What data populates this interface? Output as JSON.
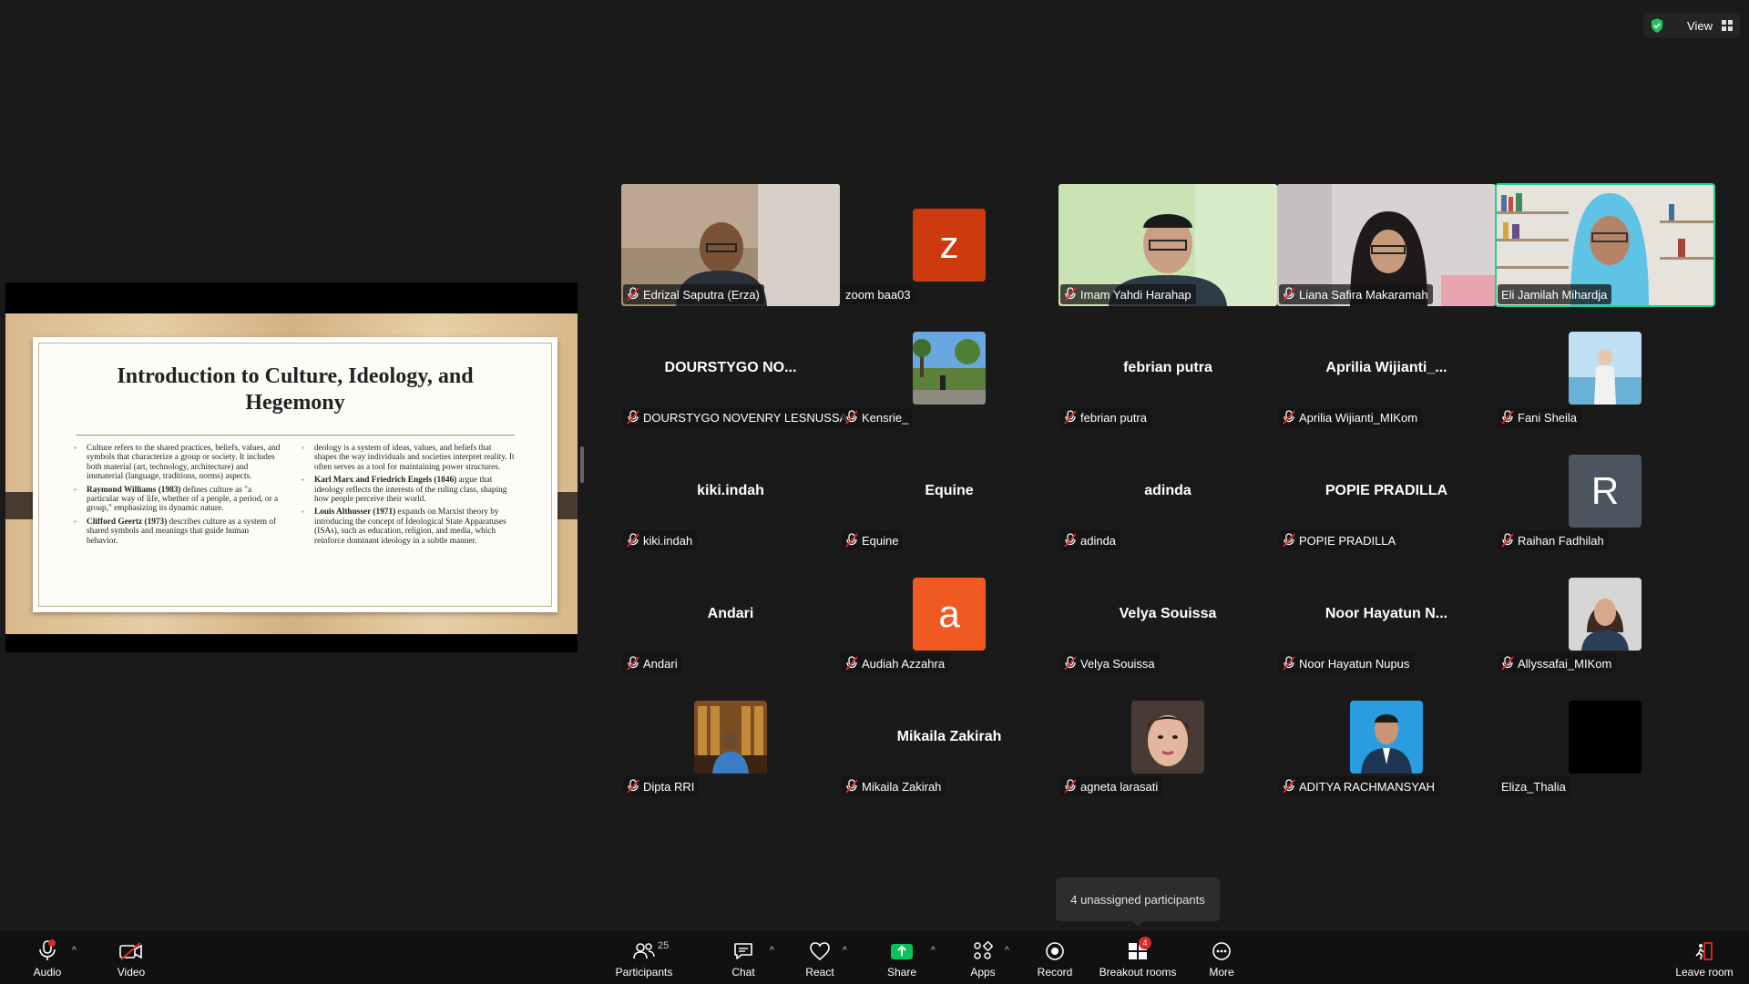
{
  "topbar": {
    "view_label": "View"
  },
  "slide": {
    "title": "Introduction to Culture, Ideology, and\nHegemony",
    "left_bullets": [
      {
        "bold": "",
        "text": "Culture refers to the shared practices, beliefs, values, and symbols that characterize a group or society. It includes both material (art, technology, architecture) and immaterial (language, traditions, norms) aspects."
      },
      {
        "bold": "Raymond Williams (1983)",
        "text": " defines culture as \"a particular way of life, whether of a people, a period, or a group,\" emphasizing its dynamic nature."
      },
      {
        "bold": "Clifford Geertz (1973)",
        "text": " describes culture as a system of shared symbols and meanings that guide human behavior."
      }
    ],
    "right_bullets": [
      {
        "bold": "",
        "text": "deology is a system of ideas, values, and beliefs that shapes the way individuals and societies interpret reality. It often serves as a tool for maintaining power structures."
      },
      {
        "bold": "Karl Marx and Friedrich Engels (1846)",
        "text": " argue that ideology reflects the interests of the ruling class, shaping how people perceive their world."
      },
      {
        "bold": "Louis Althusser (1971)",
        "text": " expands on Marxist theory by introducing the concept of Ideological State Apparatuses (ISAs), such as education, religion, and media, which reinforce dominant ideology in a subtle manner."
      }
    ]
  },
  "participants": [
    {
      "name": "Edrizal Saputra (Erza)",
      "muted": true,
      "type": "video",
      "scene": "man"
    },
    {
      "name": "zoom baa03",
      "muted": false,
      "type": "avatar",
      "letter": "z",
      "color": "#cc3a0e"
    },
    {
      "name": "Imam Yahdi Harahap",
      "muted": true,
      "type": "video",
      "scene": "green"
    },
    {
      "name": "Liana Safira Makaramah",
      "muted": true,
      "type": "video",
      "scene": "hijab"
    },
    {
      "name": "Eli Jamilah Mihardja",
      "muted": false,
      "type": "video",
      "scene": "shelf",
      "active": true
    },
    {
      "name": "DOURSTYGO NOVENRY LESNUSSA",
      "muted": true,
      "type": "name",
      "big": "DOURSTYGO  NO..."
    },
    {
      "name": "Kensrie_",
      "muted": true,
      "type": "avatar",
      "photo": "park"
    },
    {
      "name": "febrian putra",
      "muted": true,
      "type": "name",
      "big": "febrian putra"
    },
    {
      "name": "Aprilia Wijianti_MIKom",
      "muted": true,
      "type": "name",
      "big": "Aprilia  Wijianti_..."
    },
    {
      "name": "Fani Sheila",
      "muted": true,
      "type": "avatar",
      "photo": "sky"
    },
    {
      "name": "kiki.indah",
      "muted": true,
      "type": "name",
      "big": "kiki.indah"
    },
    {
      "name": "Equine",
      "muted": true,
      "type": "name",
      "big": "Equine"
    },
    {
      "name": "adinda",
      "muted": true,
      "type": "name",
      "big": "adinda"
    },
    {
      "name": "POPIE PRADILLA",
      "muted": true,
      "type": "name",
      "big": "POPIE PRADILLA"
    },
    {
      "name": "Raihan Fadhilah",
      "muted": true,
      "type": "avatar",
      "letter": "R",
      "color": "#4a5560"
    },
    {
      "name": "Andari",
      "muted": true,
      "type": "name",
      "big": "Andari"
    },
    {
      "name": "Audiah Azzahra",
      "muted": true,
      "type": "avatar",
      "letter": "a",
      "color": "#f05a22"
    },
    {
      "name": "Velya Souissa",
      "muted": true,
      "type": "name",
      "big": "Velya Souissa"
    },
    {
      "name": "Noor Hayatun Nupus",
      "muted": true,
      "type": "name",
      "big": "Noor  Hayatun  N..."
    },
    {
      "name": "Allyssafai_MIKom",
      "muted": true,
      "type": "avatar",
      "photo": "woman"
    },
    {
      "name": "Dipta RRI",
      "muted": true,
      "type": "avatar",
      "photo": "office"
    },
    {
      "name": "Mikaila Zakirah",
      "muted": true,
      "type": "name",
      "big": "Mikaila Zakirah"
    },
    {
      "name": "agneta larasati",
      "muted": true,
      "type": "avatar",
      "photo": "face"
    },
    {
      "name": "ADITYA RACHMANSYAH",
      "muted": true,
      "type": "avatar",
      "photo": "bluebg"
    },
    {
      "name": "Eliza_Thalia",
      "muted": false,
      "type": "avatar",
      "photo": "black"
    }
  ],
  "tooltip": "4 unassigned participants",
  "toolbar": {
    "audio": "Audio",
    "video": "Video",
    "participants": "Participants",
    "participants_count": "25",
    "chat": "Chat",
    "react": "React",
    "share": "Share",
    "apps": "Apps",
    "record": "Record",
    "breakout": "Breakout rooms",
    "breakout_badge": "4",
    "more": "More",
    "leave": "Leave room"
  },
  "colors": {
    "active_speaker": "#23d18b",
    "share_green": "#0bc15b",
    "alert_red": "#e02828"
  }
}
